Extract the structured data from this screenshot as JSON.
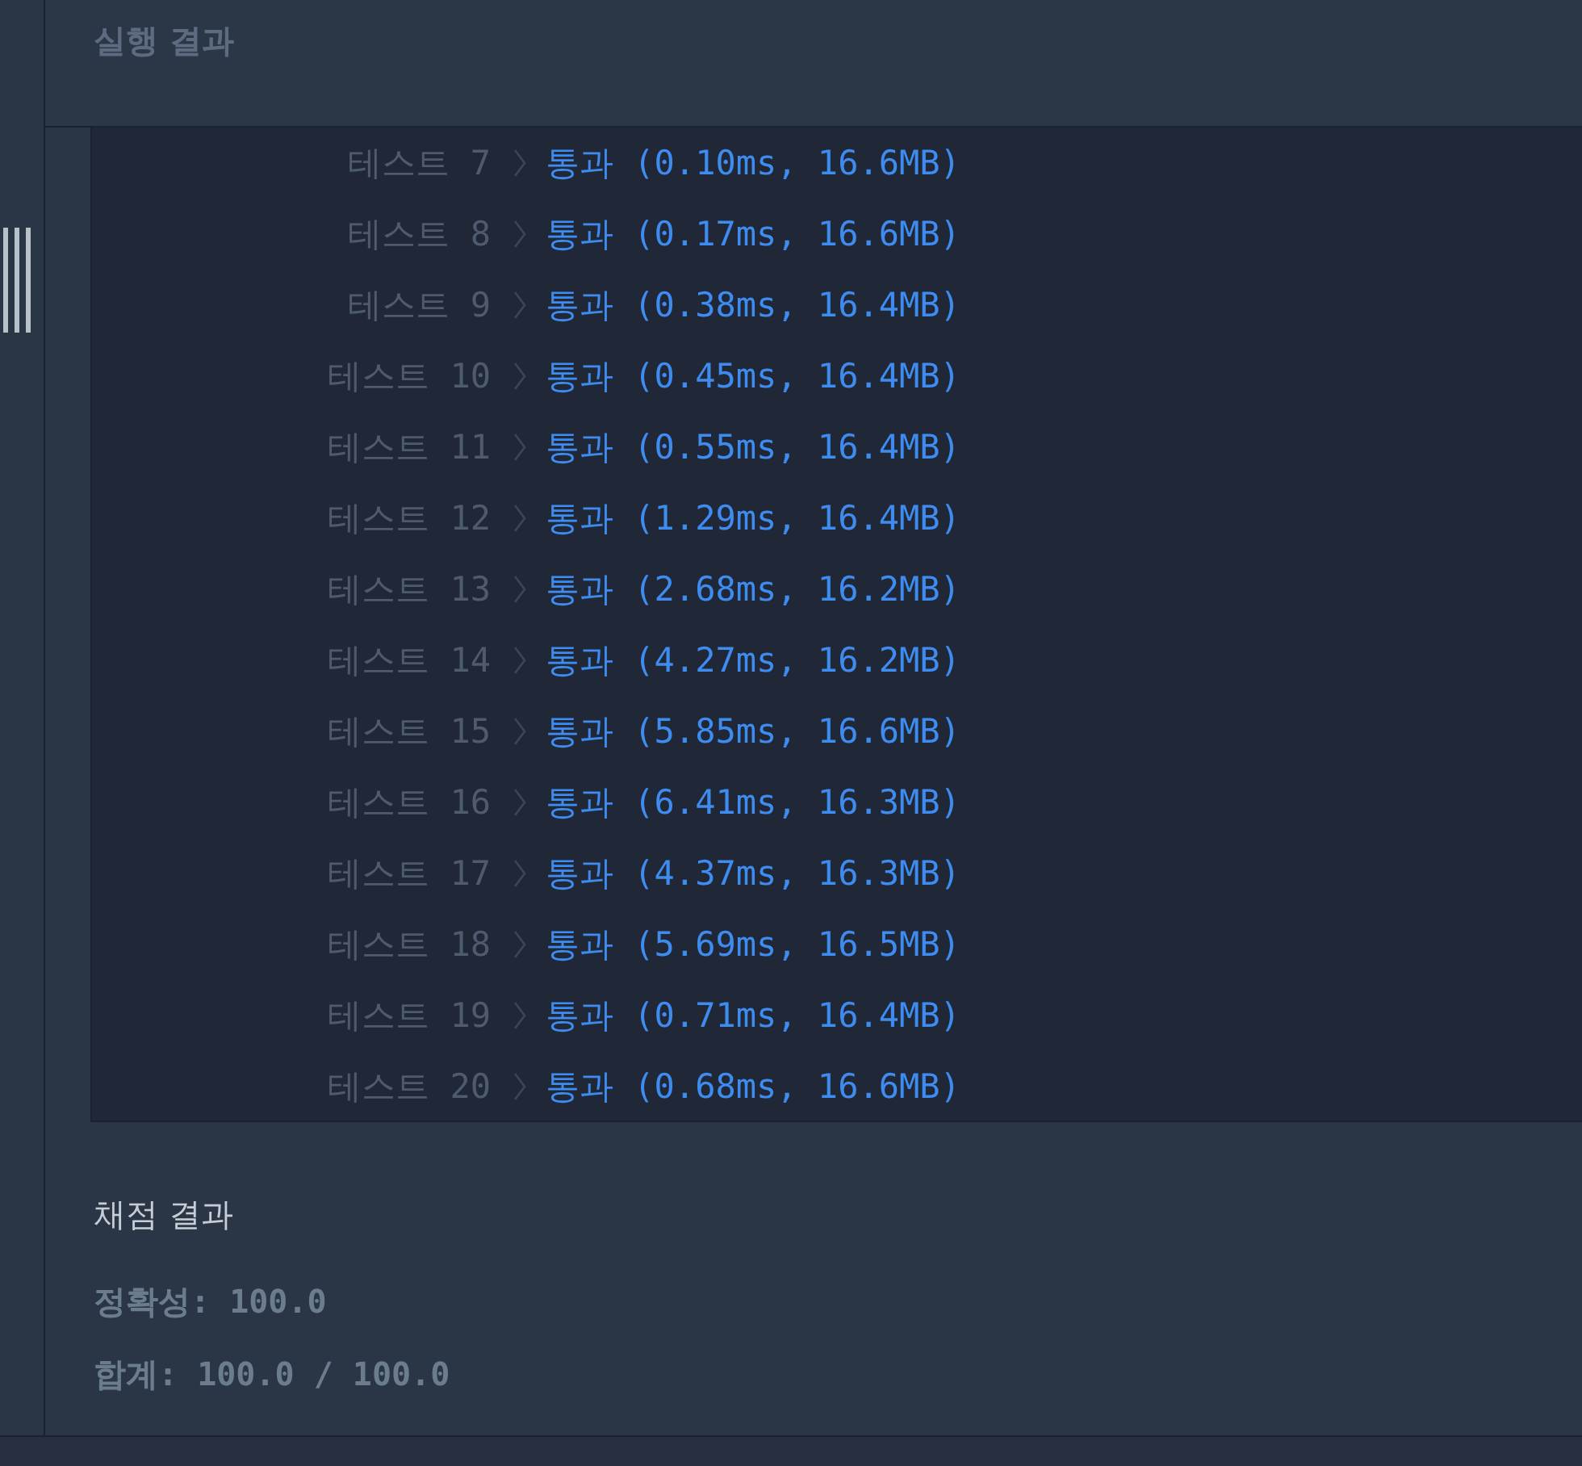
{
  "panel": {
    "title": "실행 결과"
  },
  "tests": [
    {
      "label": "테스트 7",
      "result": "통과 (0.10ms, 16.6MB)"
    },
    {
      "label": "테스트 8",
      "result": "통과 (0.17ms, 16.6MB)"
    },
    {
      "label": "테스트 9",
      "result": "통과 (0.38ms, 16.4MB)"
    },
    {
      "label": "테스트 10",
      "result": "통과 (0.45ms, 16.4MB)"
    },
    {
      "label": "테스트 11",
      "result": "통과 (0.55ms, 16.4MB)"
    },
    {
      "label": "테스트 12",
      "result": "통과 (1.29ms, 16.4MB)"
    },
    {
      "label": "테스트 13",
      "result": "통과 (2.68ms, 16.2MB)"
    },
    {
      "label": "테스트 14",
      "result": "통과 (4.27ms, 16.2MB)"
    },
    {
      "label": "테스트 15",
      "result": "통과 (5.85ms, 16.6MB)"
    },
    {
      "label": "테스트 16",
      "result": "통과 (6.41ms, 16.3MB)"
    },
    {
      "label": "테스트 17",
      "result": "통과 (4.37ms, 16.3MB)"
    },
    {
      "label": "테스트 18",
      "result": "통과 (5.69ms, 16.5MB)"
    },
    {
      "label": "테스트 19",
      "result": "통과 (0.71ms, 16.4MB)"
    },
    {
      "label": "테스트 20",
      "result": "통과 (0.68ms, 16.6MB)"
    }
  ],
  "grading": {
    "title": "채점 결과",
    "lines": [
      "정확성: 100.0",
      "합계: 100.0 / 100.0"
    ]
  }
}
